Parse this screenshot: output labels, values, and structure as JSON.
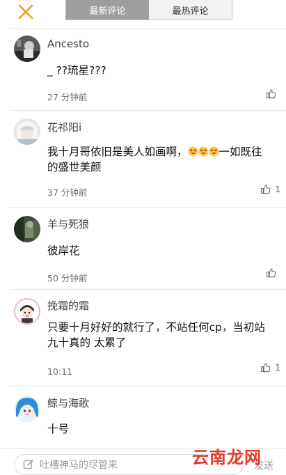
{
  "header": {
    "close_icon": "close-x-icon",
    "accent_color": "#f29b1d",
    "tabs": [
      {
        "label": "最新评论",
        "active": true
      },
      {
        "label": "最热评论",
        "active": false
      }
    ]
  },
  "comments": [
    {
      "name": "Ancesto",
      "text": "_ ??琉星???",
      "time": "27 分钟前",
      "likes": "",
      "avatar_icon": "avatar-photo-dark"
    },
    {
      "name": "花祁阳i",
      "text_before": "我十月哥依旧是美人如画啊，",
      "text_after": "一如既往的盛世美颜",
      "emoji_count": 3,
      "emoji_icon": "heart-eyes-emoji",
      "time": "37 分钟前",
      "likes": "1",
      "avatar_icon": "avatar-photo-anime-white"
    },
    {
      "name": "羊与死狼",
      "text": "彼岸花",
      "time": "50 分钟前",
      "likes": "",
      "avatar_icon": "avatar-photo-dark-green"
    },
    {
      "name": "挽霜的霜",
      "text": "只要十月好好的就行了，不站任何cp，当初站九十真的 太累了",
      "time": "10:11",
      "likes": "1",
      "avatar_icon": "avatar-cartoon-boy"
    },
    {
      "name": "鲸与海歌",
      "text": "十号",
      "time": "",
      "likes": "",
      "avatar_icon": "avatar-anime-blue-hair"
    }
  ],
  "bottom_bar": {
    "placeholder": "吐槽神马的尽管来",
    "send_label": "发送",
    "edit_icon": "edit-icon"
  },
  "watermark": "云南龙网"
}
